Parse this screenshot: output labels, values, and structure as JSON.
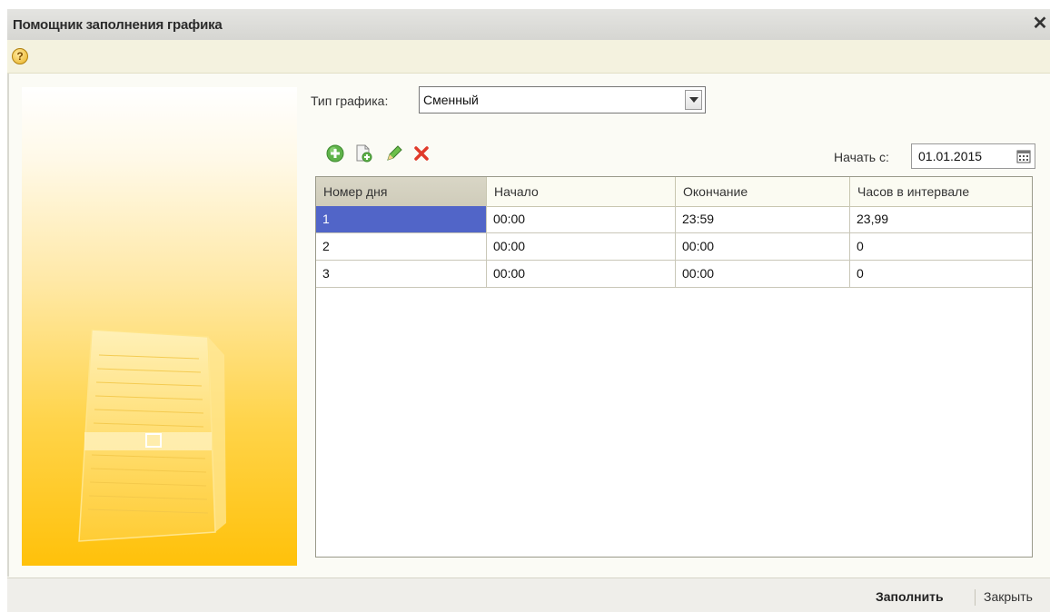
{
  "window": {
    "title": "Помощник заполнения графика"
  },
  "form": {
    "schedule_type_label": "Тип графика:",
    "schedule_type_value": "Сменный",
    "start_label": "Начать с:",
    "start_value": "01.01.2015"
  },
  "toolbar": {
    "icons": [
      "add-icon",
      "copy-icon",
      "edit-icon",
      "delete-icon"
    ]
  },
  "table": {
    "columns": [
      "Номер дня",
      "Начало",
      "Окончание",
      "Часов в  интервале"
    ],
    "rows": [
      [
        "1",
        "00:00",
        "23:59",
        "23,99"
      ],
      [
        "2",
        "00:00",
        "00:00",
        "0"
      ],
      [
        "3",
        "00:00",
        "00:00",
        "0"
      ]
    ]
  },
  "buttons": {
    "fill": "Заполнить",
    "close": "Закрыть"
  },
  "colors": {
    "selection": "#5165c8",
    "accent_yellow": "#ffc10a"
  }
}
